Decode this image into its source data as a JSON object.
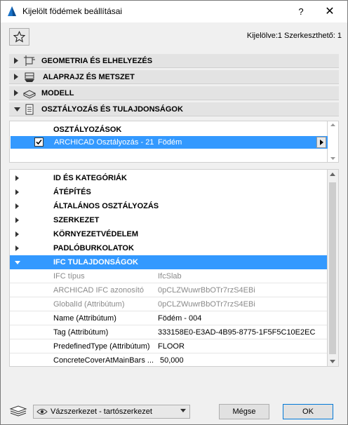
{
  "window": {
    "title": "Kijelölt födémek beállításai",
    "help_glyph": "?",
    "close_glyph": "✕"
  },
  "toolbar": {
    "selection_info": "Kijelölve:1 Szerkeszthető: 1"
  },
  "panels": [
    {
      "label": "GEOMETRIA ÉS ELHELYEZÉS",
      "icon": "geometry-icon",
      "expanded": false
    },
    {
      "label": "ALAPRAJZ ÉS METSZET",
      "icon": "floorplan-section-icon",
      "expanded": false
    },
    {
      "label": "MODELL",
      "icon": "model-icon",
      "expanded": false
    },
    {
      "label": "OSZTÁLYOZÁS ÉS TULAJDONSÁGOK",
      "icon": "classification-icon",
      "expanded": true
    }
  ],
  "classification": {
    "header": "OSZTÁLYOZÁSOK",
    "row": {
      "system": "ARCHICAD Osztályozás - 21",
      "value": "Födém",
      "checked": true
    }
  },
  "property_groups": [
    {
      "label": "ID ÉS KATEGÓRIÁK",
      "expanded": false
    },
    {
      "label": "ÁTÉPÍTÉS",
      "expanded": false
    },
    {
      "label": "ÁLTALÁNOS OSZTÁLYOZÁS",
      "expanded": false
    },
    {
      "label": "SZERKEZET",
      "expanded": false
    },
    {
      "label": "KÖRNYEZETVÉDELEM",
      "expanded": false
    },
    {
      "label": "PADLÓBURKOLATOK",
      "expanded": false
    },
    {
      "label": "IFC TULAJDONSÁGOK",
      "expanded": true
    }
  ],
  "ifc_properties": [
    {
      "name": "IFC típus",
      "value": "IfcSlab",
      "readonly": true
    },
    {
      "name": "ARCHICAD IFC azonosító",
      "value": "0pCLZWuwrBbOTr7rzS4EBi",
      "readonly": true
    },
    {
      "name": "GlobalId (Attribútum)",
      "value": "0pCLZWuwrBbOTr7rzS4EBi",
      "readonly": true
    },
    {
      "name": "Name (Attribútum)",
      "value": "Födém - 004",
      "readonly": false
    },
    {
      "name": "Tag (Attribútum)",
      "value": "333158E0-E3AD-4B95-8775-1F5F5C10E2EC",
      "readonly": false
    },
    {
      "name": "PredefinedType (Attribútum)",
      "value": "FLOOR",
      "readonly": false
    },
    {
      "name": "ConcreteCoverAtMainBars ...",
      "value": "50,000",
      "readonly": false
    }
  ],
  "footer": {
    "layer": "Vázszerkezet - tartószerkezet",
    "cancel_label": "Mégse",
    "ok_label": "OK"
  }
}
